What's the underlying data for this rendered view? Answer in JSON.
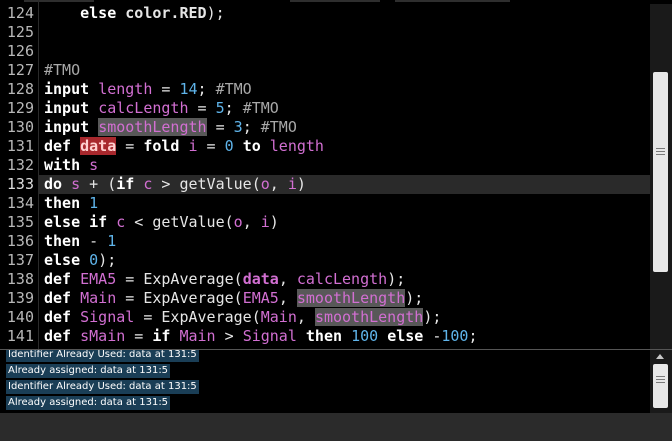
{
  "editor": {
    "lines": [
      {
        "num": "124",
        "tokens": [
          {
            "t": "    "
          },
          {
            "t": "else",
            "c": "kw"
          },
          {
            "t": " "
          },
          {
            "t": "color.RED",
            "c": "bold"
          },
          {
            "t": ");"
          }
        ]
      },
      {
        "num": "125",
        "tokens": []
      },
      {
        "num": "126",
        "tokens": []
      },
      {
        "num": "127",
        "tokens": [
          {
            "t": "#TMO",
            "c": "cm"
          }
        ]
      },
      {
        "num": "128",
        "tokens": [
          {
            "t": "input",
            "c": "kw"
          },
          {
            "t": " "
          },
          {
            "t": "length",
            "c": "id"
          },
          {
            "t": " = "
          },
          {
            "t": "14",
            "c": "num"
          },
          {
            "t": "; "
          },
          {
            "t": "#TMO",
            "c": "cm"
          }
        ]
      },
      {
        "num": "129",
        "tokens": [
          {
            "t": "input",
            "c": "kw"
          },
          {
            "t": " "
          },
          {
            "t": "calcLength",
            "c": "id"
          },
          {
            "t": " = "
          },
          {
            "t": "5",
            "c": "num"
          },
          {
            "t": "; "
          },
          {
            "t": "#TMO",
            "c": "cm"
          }
        ]
      },
      {
        "num": "130",
        "tokens": [
          {
            "t": "input",
            "c": "kw"
          },
          {
            "t": " "
          },
          {
            "t": "smoothLength",
            "c": "id sel-gray"
          },
          {
            "t": " = "
          },
          {
            "t": "3",
            "c": "num"
          },
          {
            "t": "; "
          },
          {
            "t": "#TMO",
            "c": "cm"
          }
        ]
      },
      {
        "num": "131",
        "tokens": [
          {
            "t": "def",
            "c": "kw"
          },
          {
            "t": " "
          },
          {
            "t": "data",
            "c": "sel-red bold"
          },
          {
            "t": " = "
          },
          {
            "t": "fold",
            "c": "kw"
          },
          {
            "t": " "
          },
          {
            "t": "i",
            "c": "id"
          },
          {
            "t": " = "
          },
          {
            "t": "0",
            "c": "num"
          },
          {
            "t": " "
          },
          {
            "t": "to",
            "c": "kw"
          },
          {
            "t": " "
          },
          {
            "t": "length",
            "c": "id"
          }
        ]
      },
      {
        "num": "132",
        "tokens": [
          {
            "t": "with",
            "c": "kw"
          },
          {
            "t": " "
          },
          {
            "t": "s",
            "c": "id"
          }
        ]
      },
      {
        "num": "133",
        "active": true,
        "tokens": [
          {
            "t": "do",
            "c": "kw"
          },
          {
            "t": " "
          },
          {
            "t": "s",
            "c": "id"
          },
          {
            "t": " + ("
          },
          {
            "t": "if",
            "c": "kw"
          },
          {
            "t": " "
          },
          {
            "t": "c",
            "c": "id"
          },
          {
            "t": " > getValue("
          },
          {
            "t": "o",
            "c": "id"
          },
          {
            "t": ", "
          },
          {
            "t": "i",
            "c": "id"
          },
          {
            "t": ")"
          }
        ]
      },
      {
        "num": "134",
        "tokens": [
          {
            "t": "then",
            "c": "kw"
          },
          {
            "t": " "
          },
          {
            "t": "1",
            "c": "num"
          }
        ]
      },
      {
        "num": "135",
        "tokens": [
          {
            "t": "else",
            "c": "kw"
          },
          {
            "t": " "
          },
          {
            "t": "if",
            "c": "kw"
          },
          {
            "t": " "
          },
          {
            "t": "c",
            "c": "id"
          },
          {
            "t": " < getValue("
          },
          {
            "t": "o",
            "c": "id"
          },
          {
            "t": ", "
          },
          {
            "t": "i",
            "c": "id"
          },
          {
            "t": ")"
          }
        ]
      },
      {
        "num": "136",
        "tokens": [
          {
            "t": "then",
            "c": "kw"
          },
          {
            "t": " - "
          },
          {
            "t": "1",
            "c": "num"
          }
        ]
      },
      {
        "num": "137",
        "tokens": [
          {
            "t": "else",
            "c": "kw"
          },
          {
            "t": " "
          },
          {
            "t": "0",
            "c": "num"
          },
          {
            "t": ");"
          }
        ]
      },
      {
        "num": "138",
        "tokens": [
          {
            "t": "def",
            "c": "kw"
          },
          {
            "t": " "
          },
          {
            "t": "EMA5",
            "c": "id"
          },
          {
            "t": " = ExpAverage("
          },
          {
            "t": "data",
            "c": "id bold"
          },
          {
            "t": ", "
          },
          {
            "t": "calcLength",
            "c": "id"
          },
          {
            "t": ");"
          }
        ]
      },
      {
        "num": "139",
        "tokens": [
          {
            "t": "def",
            "c": "kw"
          },
          {
            "t": " "
          },
          {
            "t": "Main",
            "c": "id"
          },
          {
            "t": " = ExpAverage("
          },
          {
            "t": "EMA5",
            "c": "id"
          },
          {
            "t": ", "
          },
          {
            "t": "smoothLength",
            "c": "id sel-gray"
          },
          {
            "t": ");"
          }
        ]
      },
      {
        "num": "140",
        "tokens": [
          {
            "t": "def",
            "c": "kw"
          },
          {
            "t": " "
          },
          {
            "t": "Signal",
            "c": "id"
          },
          {
            "t": " = ExpAverage("
          },
          {
            "t": "Main",
            "c": "id"
          },
          {
            "t": ", "
          },
          {
            "t": "smoothLength",
            "c": "id sel-gray"
          },
          {
            "t": ");"
          }
        ]
      },
      {
        "num": "141",
        "tokens": [
          {
            "t": "def",
            "c": "kw"
          },
          {
            "t": " "
          },
          {
            "t": "sMain",
            "c": "id"
          },
          {
            "t": " = "
          },
          {
            "t": "if",
            "c": "kw"
          },
          {
            "t": " "
          },
          {
            "t": "Main",
            "c": "id"
          },
          {
            "t": " > "
          },
          {
            "t": "Signal",
            "c": "id"
          },
          {
            "t": " "
          },
          {
            "t": "then",
            "c": "kw"
          },
          {
            "t": " "
          },
          {
            "t": "100",
            "c": "num"
          },
          {
            "t": " "
          },
          {
            "t": "else",
            "c": "kw"
          },
          {
            "t": " -"
          },
          {
            "t": "100",
            "c": "num"
          },
          {
            "t": ";"
          }
        ]
      }
    ]
  },
  "console": {
    "messages": [
      "Identifier Already Used: data at 131:5",
      "Already assigned: data at 131:5",
      "Identifier Already Used: data at 131:5",
      "Already assigned: data at 131:5"
    ]
  },
  "colors": {
    "background": "#000000",
    "keyword": "#ffffff",
    "identifier": "#d26fd2",
    "number": "#5fb4ea",
    "comment": "#a8a8a8",
    "error_highlight": "#a8282d",
    "message_background": "#1a3e56"
  }
}
